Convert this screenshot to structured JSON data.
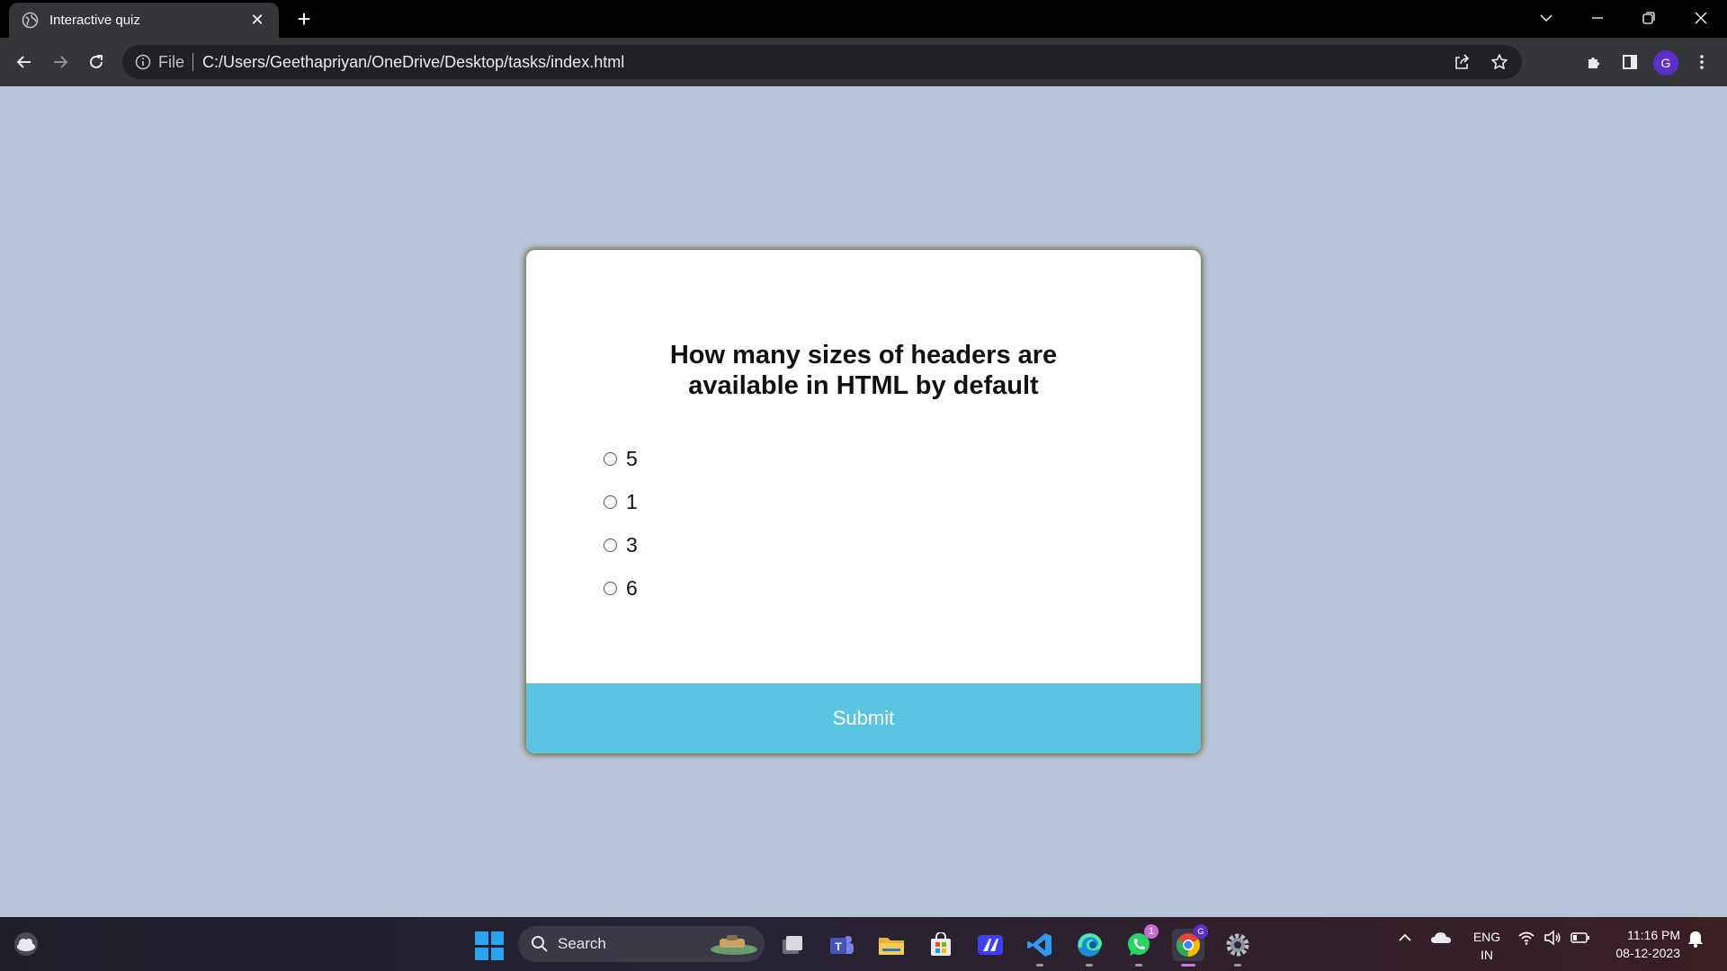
{
  "browser": {
    "tab_title": "Interactive quiz",
    "new_tab_symbol": "+",
    "close_symbol": "✕",
    "file_label": "File",
    "url": "C:/Users/Geethapriyan/OneDrive/Desktop/tasks/index.html",
    "profile_initial": "G"
  },
  "quiz": {
    "question": "How many sizes of headers are available in HTML by default",
    "options": [
      {
        "label": "5"
      },
      {
        "label": "1"
      },
      {
        "label": "3"
      },
      {
        "label": "6"
      }
    ],
    "submit_label": "Submit"
  },
  "taskbar": {
    "search_label": "Search",
    "whatsapp_badge": "1",
    "language": "ENG",
    "region": "IN",
    "time": "11:16 PM",
    "date": "08-12-2023"
  },
  "colors": {
    "page_background": "#b9c4d9",
    "submit_button": "#5bc5e1",
    "card_shadow": "#6b6a3f"
  }
}
